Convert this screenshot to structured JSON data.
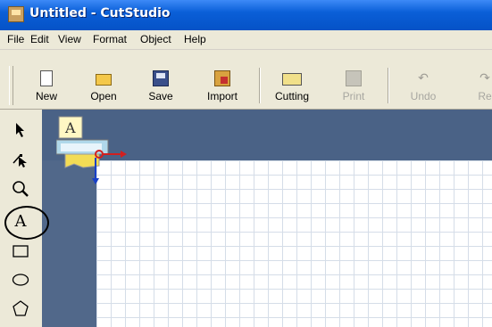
{
  "window": {
    "title": "Untitled - CutStudio"
  },
  "menu": [
    "File",
    "Edit",
    "View",
    "Format",
    "Object",
    "Help"
  ],
  "toolbar": {
    "buttons": [
      {
        "label": "New",
        "icon": "new-document-icon",
        "enabled": true
      },
      {
        "label": "Open",
        "icon": "open-folder-icon",
        "enabled": true
      },
      {
        "label": "Save",
        "icon": "save-disk-icon",
        "enabled": true
      },
      {
        "label": "Import",
        "icon": "import-icon",
        "enabled": true
      },
      {
        "label": "Cutting",
        "icon": "cutting-icon",
        "enabled": true
      },
      {
        "label": "Print",
        "icon": "print-icon",
        "enabled": false
      },
      {
        "label": "Undo",
        "icon": "undo-icon",
        "enabled": false
      },
      {
        "label": "Re",
        "icon": "redo-icon",
        "enabled": false
      }
    ]
  },
  "tools": [
    {
      "name": "select-tool",
      "icon": "arrow-pointer-icon"
    },
    {
      "name": "node-edit-tool",
      "icon": "node-edit-icon"
    },
    {
      "name": "zoom-tool",
      "icon": "magnifier-icon"
    },
    {
      "name": "text-tool",
      "icon": "text-icon",
      "label": "A",
      "highlighted": true
    },
    {
      "name": "rectangle-tool",
      "icon": "rectangle-icon"
    },
    {
      "name": "ellipse-tool",
      "icon": "ellipse-icon"
    },
    {
      "name": "polygon-tool",
      "icon": "pentagon-icon"
    }
  ],
  "canvas": {
    "origin_marker_letter": "A"
  },
  "colors": {
    "titlebar": "#0a5fd8",
    "chrome": "#ece9d8",
    "workspace": "#51688a",
    "grid_line": "#d5dde8",
    "axis_x": "#d11f1f",
    "axis_y": "#1840c8"
  }
}
